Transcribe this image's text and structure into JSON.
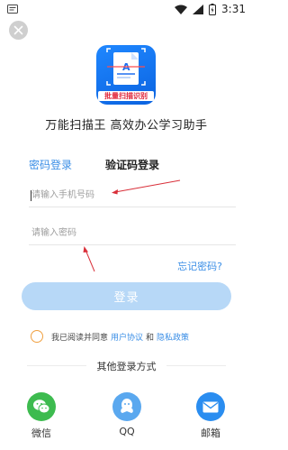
{
  "status_bar": {
    "time": "3:31"
  },
  "app": {
    "logo_caption": "批量扫描识别",
    "tagline": "万能扫描王 高效办公学习助手"
  },
  "tabs": [
    {
      "label": "密码登录"
    },
    {
      "label": "验证码登录"
    }
  ],
  "form": {
    "phone_placeholder": "请输入手机号码",
    "password_placeholder": "请输入密码",
    "forgot_label": "忘记密码?",
    "login_label": "登录"
  },
  "agreement": {
    "prefix": "我已阅读并同意",
    "user_agreement": "用户协议",
    "and": "和",
    "privacy_policy": "隐私政策"
  },
  "other_login": {
    "title": "其他登录方式",
    "options": [
      {
        "label": "微信",
        "icon": "wechat-icon"
      },
      {
        "label": "QQ",
        "icon": "qq-icon"
      },
      {
        "label": "邮箱",
        "icon": "mail-icon"
      }
    ]
  },
  "colors": {
    "accent": "#3a8ee6",
    "login_button": "#b7d8f7",
    "annotation_red": "#d9303a",
    "wechat": "#3dbb4f",
    "qq": "#5aa8ef",
    "mail": "#2a8df0"
  }
}
